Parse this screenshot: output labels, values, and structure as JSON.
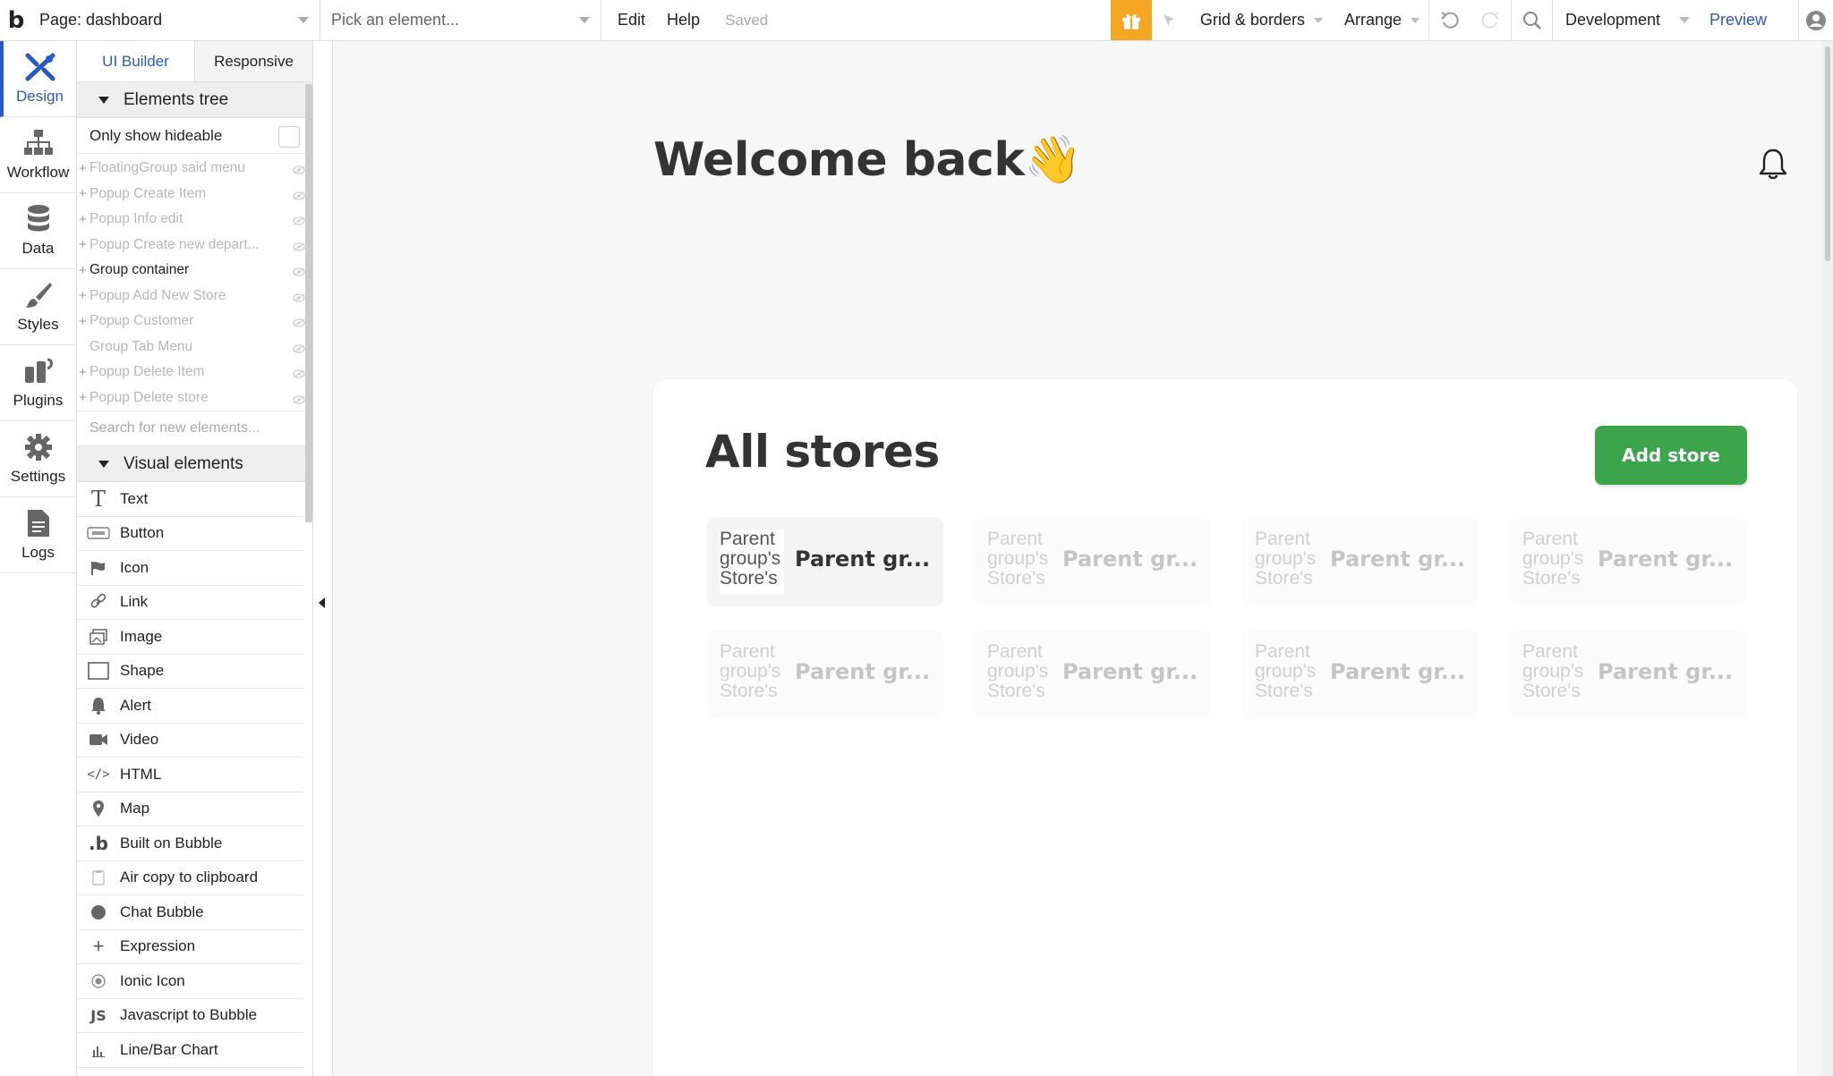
{
  "topbar": {
    "logo": "b",
    "page_label": "Page: dashboard",
    "element_placeholder": "Pick an element...",
    "menu_edit": "Edit",
    "menu_help": "Help",
    "saved": "Saved",
    "grid_borders": "Grid & borders",
    "arrange": "Arrange",
    "environment": "Development",
    "preview": "Preview",
    "gift_color": "#f5a623"
  },
  "rail": [
    {
      "label": "Design",
      "icon": "design-icon",
      "active": true
    },
    {
      "label": "Workflow",
      "icon": "workflow-icon"
    },
    {
      "label": "Data",
      "icon": "database-icon"
    },
    {
      "label": "Styles",
      "icon": "brush-icon"
    },
    {
      "label": "Plugins",
      "icon": "plugins-icon"
    },
    {
      "label": "Settings",
      "icon": "gear-icon"
    },
    {
      "label": "Logs",
      "icon": "document-icon"
    }
  ],
  "panel": {
    "tab_builder": "UI Builder",
    "tab_responsive": "Responsive",
    "elements_tree": "Elements tree",
    "only_show_hideable": "Only show hideable",
    "tree": [
      {
        "label": "FloatingGroup said menu",
        "plus": true,
        "dark": false
      },
      {
        "label": "Popup Create Item",
        "plus": true,
        "dark": false
      },
      {
        "label": "Popup Info edit",
        "plus": true,
        "dark": false
      },
      {
        "label": "Popup Create new depart...",
        "plus": true,
        "dark": false
      },
      {
        "label": "Group container",
        "plus": true,
        "dark": true
      },
      {
        "label": "Popup Add New Store",
        "plus": true,
        "dark": false
      },
      {
        "label": "Popup Customer",
        "plus": true,
        "dark": false
      },
      {
        "label": "Group Tab Menu",
        "plus": false,
        "dark": false
      },
      {
        "label": "Popup Delete Item",
        "plus": true,
        "dark": false
      },
      {
        "label": "Popup Delete store",
        "plus": true,
        "dark": false
      }
    ],
    "search_placeholder": "Search for new elements...",
    "visual_elements": "Visual elements",
    "visual": [
      {
        "label": "Text",
        "icon": "text-icon"
      },
      {
        "label": "Button",
        "icon": "button-icon"
      },
      {
        "label": "Icon",
        "icon": "flag-icon"
      },
      {
        "label": "Link",
        "icon": "link-icon"
      },
      {
        "label": "Image",
        "icon": "image-icon"
      },
      {
        "label": "Shape",
        "icon": "shape-icon"
      },
      {
        "label": "Alert",
        "icon": "bell-icon"
      },
      {
        "label": "Video",
        "icon": "video-icon"
      },
      {
        "label": "HTML",
        "icon": "code-icon"
      },
      {
        "label": "Map",
        "icon": "map-pin-icon"
      },
      {
        "label": "Built on Bubble",
        "icon": "bubble-logo-icon"
      },
      {
        "label": "Air copy to clipboard",
        "icon": "clipboard-icon"
      },
      {
        "label": "Chat Bubble",
        "icon": "chat-bubble-icon"
      },
      {
        "label": "Expression",
        "icon": "plus-icon"
      },
      {
        "label": "Ionic Icon",
        "icon": "ionic-icon"
      },
      {
        "label": "Javascript to Bubble",
        "icon": "js-icon"
      },
      {
        "label": "Line/Bar Chart",
        "icon": "bar-chart-icon"
      }
    ]
  },
  "canvas": {
    "welcome": "Welcome back👋",
    "card_title": "All stores",
    "add_store": "Add store",
    "accent": "#3ca54c",
    "stores": [
      {
        "img_text": "Parent group's Store's",
        "name": "Parent gr...",
        "faded": false
      },
      {
        "img_text": "Parent group's Store's",
        "name": "Parent gr...",
        "faded": true
      },
      {
        "img_text": "Parent group's Store's",
        "name": "Parent gr...",
        "faded": true
      },
      {
        "img_text": "Parent group's Store's",
        "name": "Parent gr...",
        "faded": true
      },
      {
        "img_text": "Parent group's Store's",
        "name": "Parent gr...",
        "faded": true
      },
      {
        "img_text": "Parent group's Store's",
        "name": "Parent gr...",
        "faded": true
      },
      {
        "img_text": "Parent group's Store's",
        "name": "Parent gr...",
        "faded": true
      },
      {
        "img_text": "Parent group's Store's",
        "name": "Parent gr...",
        "faded": true
      }
    ]
  }
}
